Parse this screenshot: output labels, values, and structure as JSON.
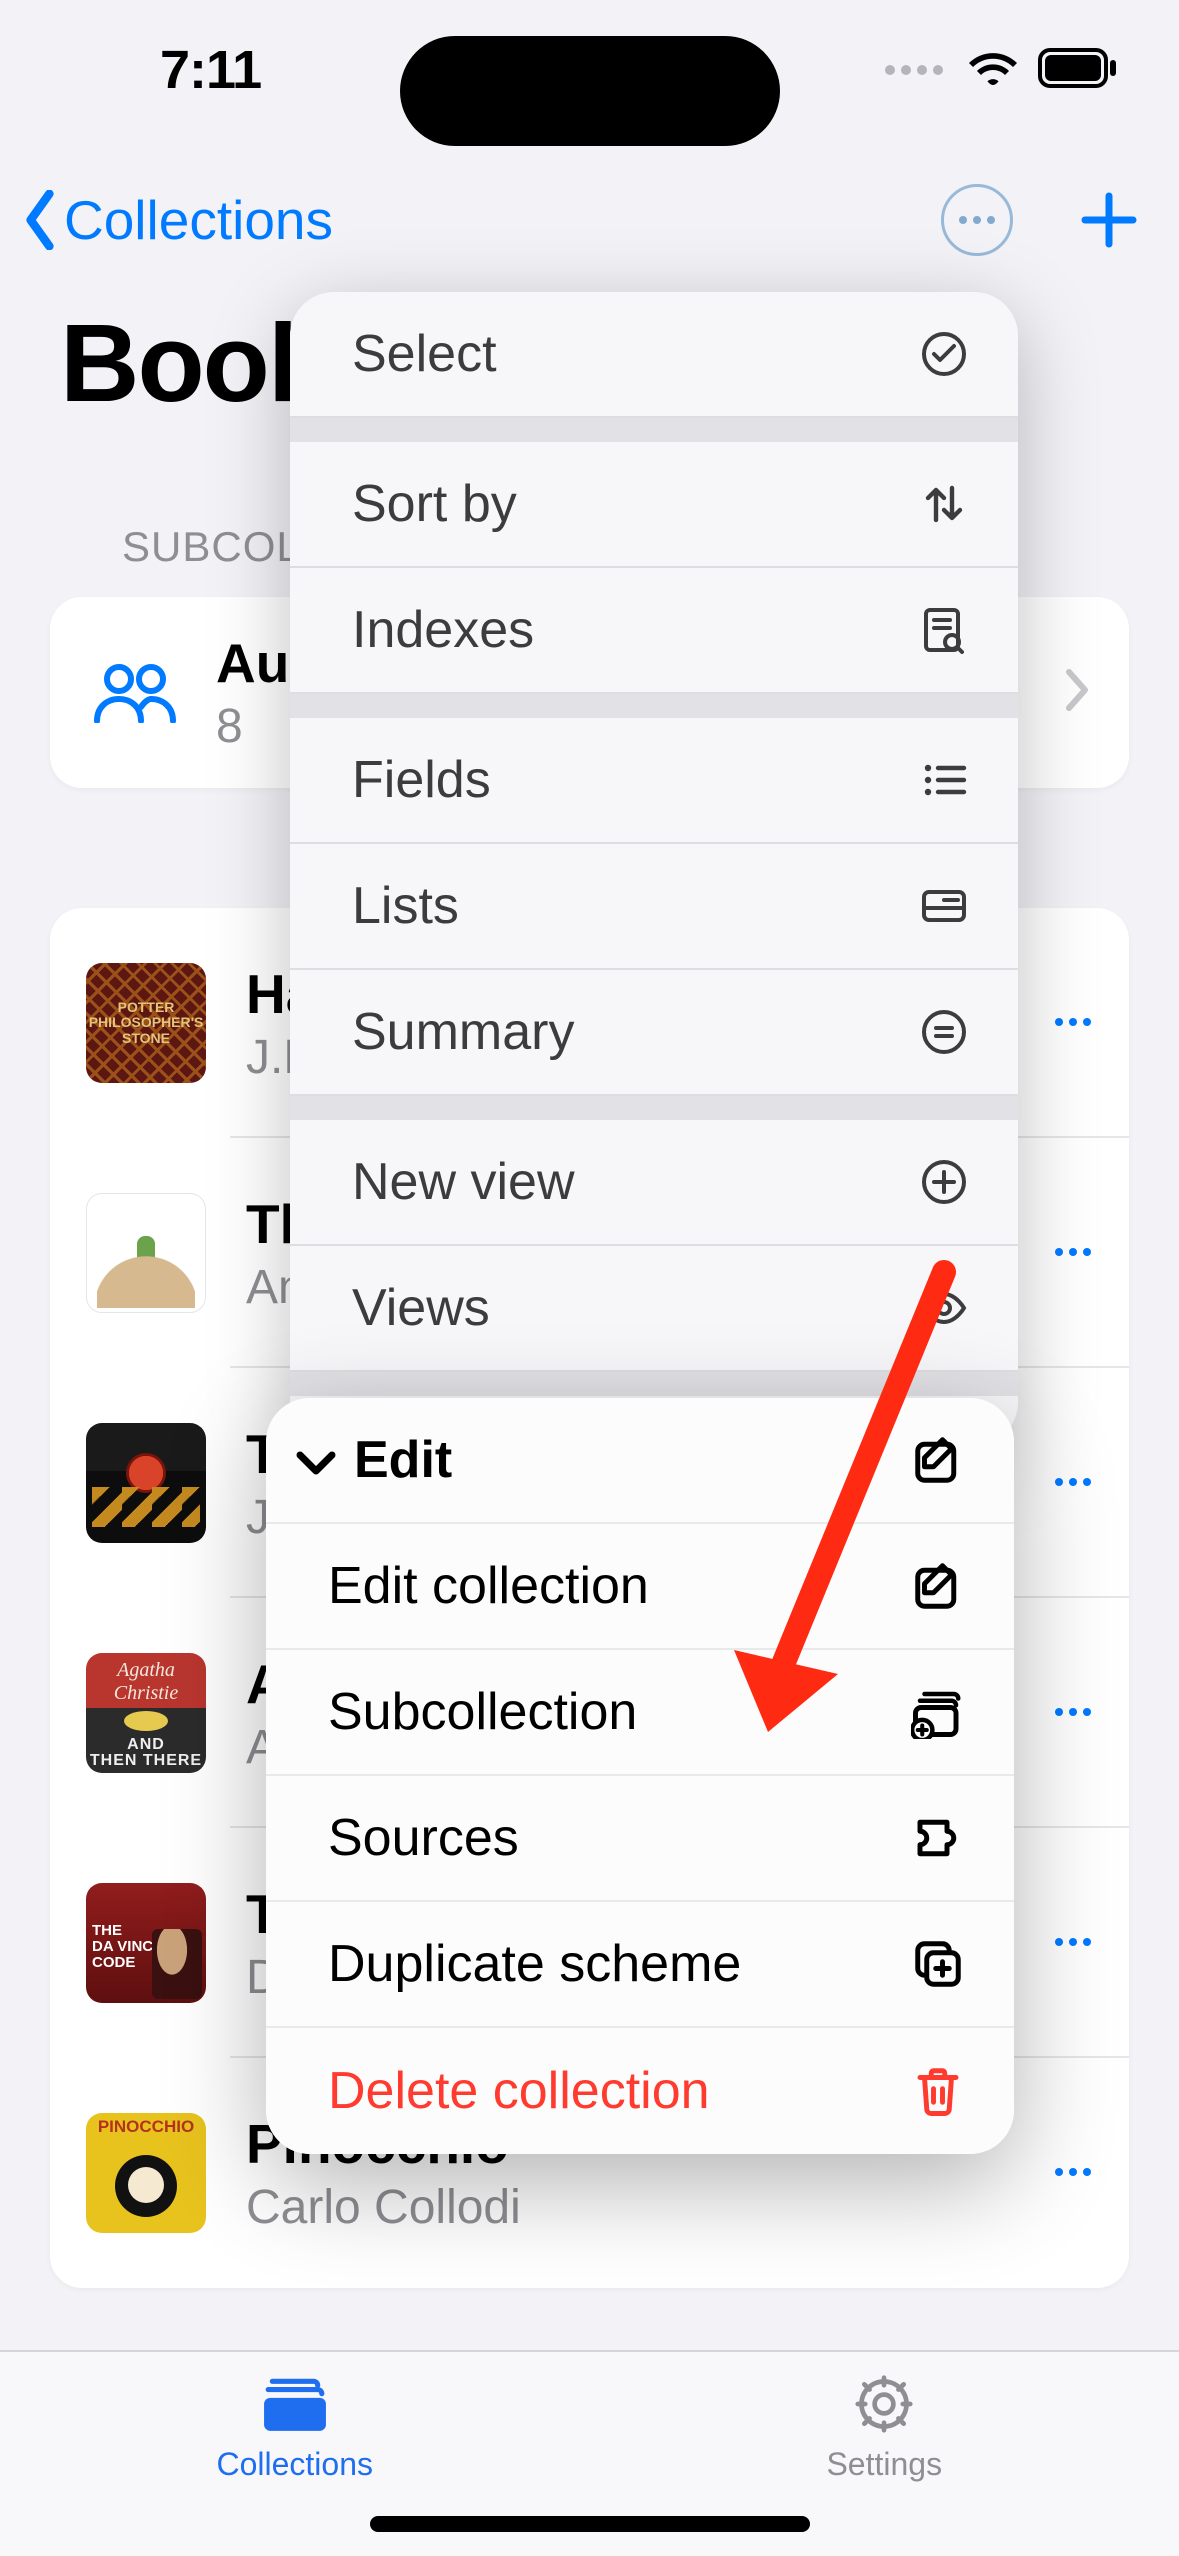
{
  "status": {
    "time": "7:11"
  },
  "nav": {
    "back_label": "Collections"
  },
  "page": {
    "title": "Books",
    "section_label": "SUBCOLLECTIONS"
  },
  "subcollection": {
    "name": "Authors",
    "count": "8"
  },
  "books": [
    {
      "title": "Harry Potter",
      "subtitle": "J.K. Rowling",
      "cover": "potter"
    },
    {
      "title": "The Little Prince",
      "subtitle": "Antoine de Saint-Exupéry",
      "cover": "prince"
    },
    {
      "title": "The Hobbit",
      "subtitle": "J.R.R. Tolkien",
      "cover": "hobbit"
    },
    {
      "title": "And Then There Were None",
      "subtitle": "Agatha Christie",
      "cover": "christie"
    },
    {
      "title": "The Da Vinci Code",
      "subtitle": "Dan Brown",
      "cover": "davinci"
    },
    {
      "title": "Pinocchio",
      "subtitle": "Carlo Collodi",
      "cover": "pinocchio"
    }
  ],
  "menu1": {
    "select": "Select",
    "sort_by": "Sort by",
    "indexes": "Indexes",
    "fields": "Fields",
    "lists": "Lists",
    "summary": "Summary",
    "new_view": "New view",
    "views": "Views"
  },
  "menu2": {
    "header": "Edit",
    "edit_collection": "Edit collection",
    "subcollection": "Subcollection",
    "sources": "Sources",
    "duplicate_scheme": "Duplicate scheme",
    "delete_collection": "Delete collection"
  },
  "tabs": {
    "collections": "Collections",
    "settings": "Settings"
  },
  "colors": {
    "accent": "#007aff",
    "destructive": "#ff3b30",
    "arrow": "#ff2a12"
  }
}
